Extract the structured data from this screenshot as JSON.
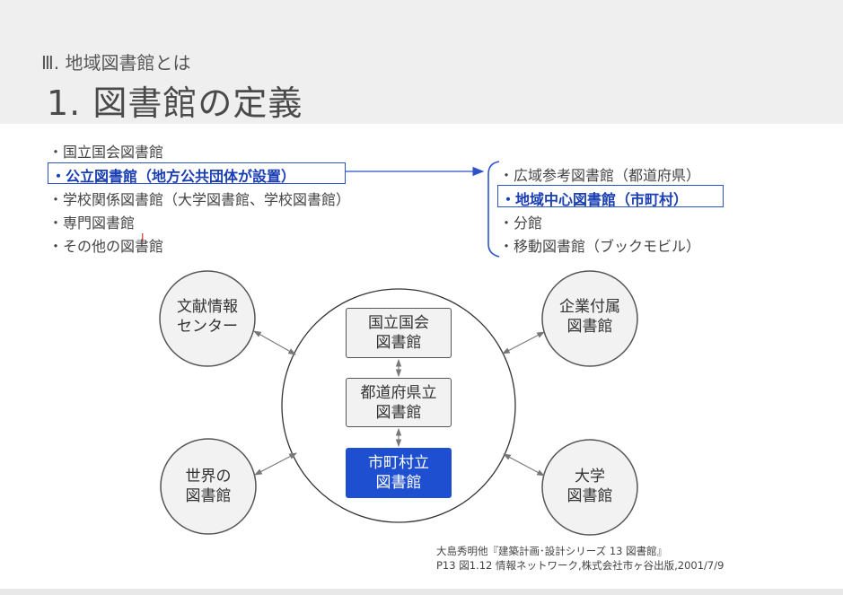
{
  "header": {
    "section": "Ⅲ. 地域図書館とは",
    "title": "1. 図書館の定義"
  },
  "left_list": [
    "・国立国会図書館",
    "・公立図書館（地方公共団体が設置）",
    "・学校関係図書館（大学図書館、学校図書館）",
    "・専門図書館",
    "・その他の図書館"
  ],
  "right_list": [
    "・広域参考図書館（都道府県）",
    "・地域中心図書館（市町村）",
    "・分館",
    "・移動図書館（ブックモビル）"
  ],
  "diagram": {
    "outer_nodes": {
      "top_left": [
        "文献情報",
        "センター"
      ],
      "top_right": [
        "企業付属",
        "図書館"
      ],
      "bottom_left": [
        "世界の",
        "図書館"
      ],
      "bottom_right": [
        "大学",
        "図書館"
      ]
    },
    "boxes": {
      "national": [
        "国立国会",
        "図書館"
      ],
      "prefectural": [
        "都道府県立",
        "図書館"
      ],
      "municipal": [
        "市町村立",
        "図書館"
      ]
    }
  },
  "citation": {
    "line1": "大島秀明他『建築計画･設計シリーズ 13 図書館』",
    "line2": "P13 図1.12 情報ネットワーク,株式会社市ヶ谷出版,2001/7/9"
  },
  "colors": {
    "highlight": "#1a3fb4",
    "municipal_box": "#1e4fd1",
    "header_bg": "#efefef"
  }
}
